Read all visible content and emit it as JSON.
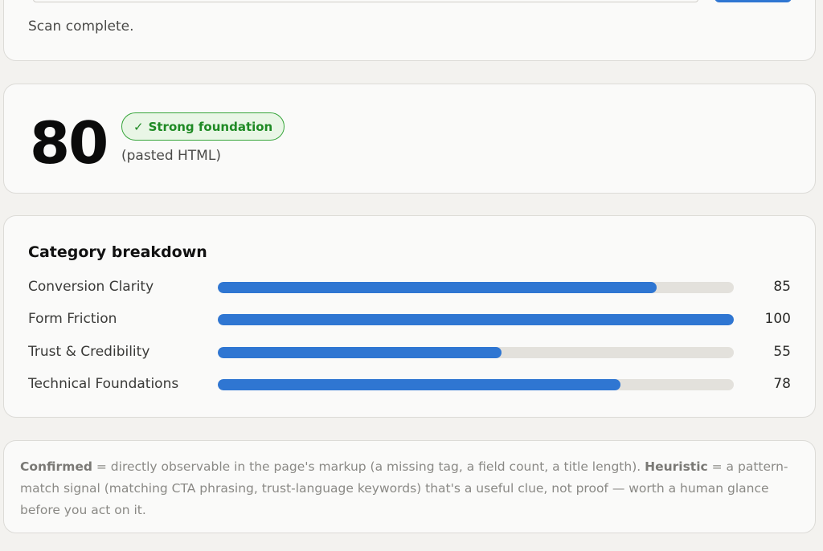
{
  "scan": {
    "status_text": "Scan complete."
  },
  "score": {
    "value": "80",
    "badge_label": "Strong foundation",
    "badge_icon": "check-icon",
    "source_note": "(pasted HTML)"
  },
  "categories": {
    "title": "Category breakdown",
    "items": [
      {
        "label": "Conversion Clarity",
        "value": "85",
        "score": 85
      },
      {
        "label": "Form Friction",
        "value": "100",
        "score": 100
      },
      {
        "label": "Trust & Credibility",
        "value": "55",
        "score": 55
      },
      {
        "label": "Technical Foundations",
        "value": "78",
        "score": 78
      }
    ]
  },
  "legend": {
    "confirmed_term": "Confirmed",
    "confirmed_desc": " = directly observable in the page's markup (a missing tag, a field count, a title length). ",
    "heuristic_term": "Heuristic",
    "heuristic_desc": " = a pattern-match signal (matching CTA phrasing, trust-language keywords) that's a useful clue, not proof — worth a human glance before you act on it."
  },
  "colors": {
    "accent": "#2f76d2",
    "track": "#e3e1dc",
    "badge_green": "#1f8a24"
  }
}
